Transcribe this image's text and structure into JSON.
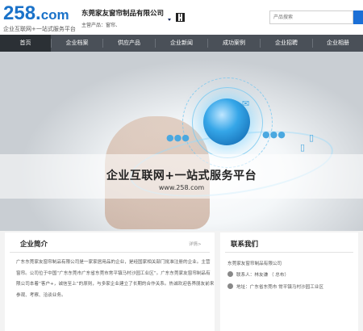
{
  "header": {
    "logo_main": "258.",
    "logo_com": "com",
    "logo_sub": "企业互联网+一站式服务平台",
    "company": "东莞家友窗帘制品有限公司",
    "products": "主营产品：窗帘、",
    "search_placeholder": "产品搜索"
  },
  "nav": {
    "items": [
      "首页",
      "企业档案",
      "供应产品",
      "企业新闻",
      "成功案例",
      "企业招聘",
      "企业相册"
    ],
    "active_index": 0
  },
  "banner": {
    "slogan": "企业互联网+一站式服务平台",
    "url": "www.258.com"
  },
  "intro": {
    "title": "企业简介",
    "more": "详情>",
    "text": "广东东莞家友窗帘制品有限公司是一家家居用品的企业，是经国家相关部门批准注册的企业。主营窗帘。公司位于中国“广东东莞市广东省东莞市常平镇马村沙园工业区”。广东东莞家友窗帘制品有限公司本着“客户+，诚信至上”的原则，与多家企业建立了长期的合作关系。热诚欢迎各界朋友前来参观、考察、洽谈业务。"
  },
  "contact": {
    "title": "联系我们",
    "company": "东莞家友窗帘制品有限公司",
    "person": "联系人：林友谦  （  总布）",
    "address": "地址：广东省东莞市 常平镇马村沙园工业区"
  },
  "colors": {
    "brand": "#1a72c9",
    "nav_bg": "#4a5058",
    "nav_active": "#2b3035",
    "search_button": "#1b6fd6"
  }
}
